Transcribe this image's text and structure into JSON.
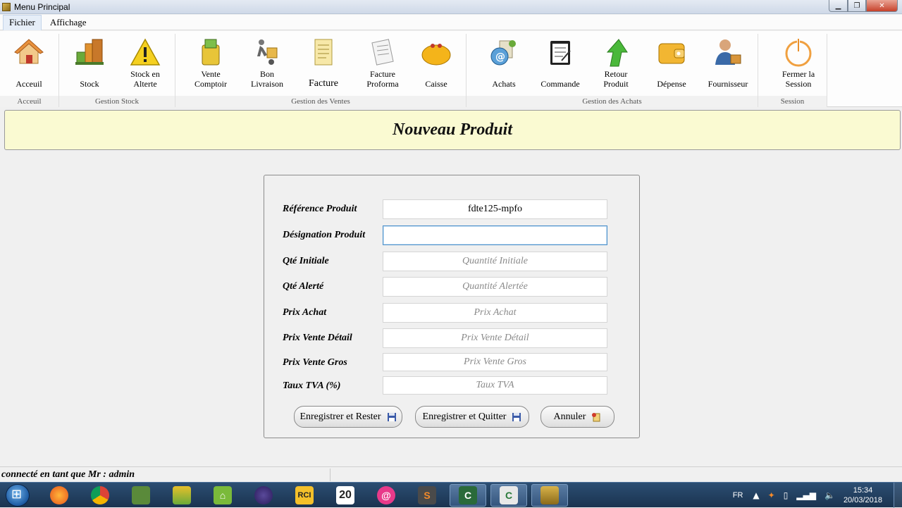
{
  "window": {
    "title": "Menu Principal",
    "min_icon": "minimize-icon",
    "max_icon": "maximize-icon",
    "close_icon": "close-icon"
  },
  "menubar": {
    "items": [
      "Fichier",
      "Affichage"
    ]
  },
  "ribbon": {
    "groups": [
      {
        "label": "Acceuil",
        "buttons": [
          {
            "label": "Acceuil",
            "icon": "home-icon"
          }
        ]
      },
      {
        "label": "Gestion Stock",
        "buttons": [
          {
            "label": "Stock",
            "icon": "boxes-icon"
          },
          {
            "label": "Stock en\nAlterte",
            "icon": "warning-icon"
          }
        ]
      },
      {
        "label": "Gestion des Ventes",
        "buttons": [
          {
            "label": "Vente\nComptoir",
            "icon": "shopping-bag-icon"
          },
          {
            "label": "Bon\nLivraison",
            "icon": "delivery-icon"
          },
          {
            "label": "Facture",
            "icon": "invoice-icon"
          },
          {
            "label": "Facture\nProforma",
            "icon": "proforma-icon"
          },
          {
            "label": "Caisse",
            "icon": "purse-icon"
          }
        ]
      },
      {
        "label": "Gestion des Achats",
        "buttons": [
          {
            "label": "Achats",
            "icon": "email-icon"
          },
          {
            "label": "Commande",
            "icon": "clipboard-icon"
          },
          {
            "label": "Retour\nProduit",
            "icon": "return-arrow-icon"
          },
          {
            "label": "Dépense",
            "icon": "wallet-icon"
          },
          {
            "label": "Fournisseur",
            "icon": "supplier-icon"
          }
        ]
      },
      {
        "label": "Session",
        "buttons": [
          {
            "label": "Fermer la\nSession",
            "icon": "power-icon"
          }
        ]
      }
    ]
  },
  "banner": {
    "title": "Nouveau Produit"
  },
  "form": {
    "fields": [
      {
        "label": "Référence Produit",
        "value": "fdte125-mpfo",
        "placeholder": ""
      },
      {
        "label": "Désignation Produit",
        "value": "",
        "placeholder": ""
      },
      {
        "label": "Qté Initiale",
        "value": "",
        "placeholder": "Quantité Initiale"
      },
      {
        "label": "Qté Alerté",
        "value": "",
        "placeholder": "Quantité Alertée"
      },
      {
        "label": "Prix Achat",
        "value": "",
        "placeholder": "Prix Achat"
      },
      {
        "label": "Prix Vente Détail",
        "value": "",
        "placeholder": "Prix Vente Détail"
      },
      {
        "label": "Prix Vente Gros",
        "value": "",
        "placeholder": "Prix Vente Gros"
      },
      {
        "label": "Taux TVA (%)",
        "value": "",
        "placeholder": "Taux TVA"
      }
    ],
    "buttons": {
      "save_stay": "Enregistrer et Rester",
      "save_quit": "Enregistrer et Quitter",
      "cancel": "Annuler"
    }
  },
  "status": {
    "text": "connecté en tant que Mr : admin"
  },
  "taskbar": {
    "apps": [
      "firefox-icon",
      "chrome-icon",
      "app-icon",
      "app-icon",
      "android-studio-icon",
      "eclipse-icon",
      "rci-icon",
      "20-icon",
      "opera-icon",
      "sublime-icon",
      "camtasia-icon",
      "camtasia-icon",
      "app-icon"
    ],
    "tray": {
      "lang": "FR",
      "time": "15:34",
      "date": "20/03/2018"
    }
  },
  "colors": {
    "banner_bg": "#fafad2",
    "focus_border": "#4a8fc9",
    "taskbar": "#1a3350"
  }
}
